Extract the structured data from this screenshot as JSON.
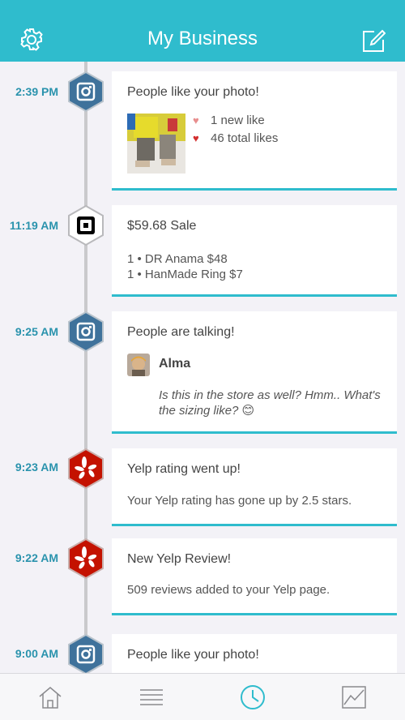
{
  "header": {
    "title": "My Business",
    "icons": [
      "gear-icon",
      "compose-icon"
    ]
  },
  "colors": {
    "accent": "#2fbccd",
    "time": "#2a93ad",
    "instagram": "#3f729b",
    "yelp": "#c41200",
    "square": "#000000"
  },
  "events": [
    {
      "time": "2:39 PM",
      "icon": "instagram-icon",
      "title": "People like your photo!",
      "new_likes": "1 new like",
      "total_likes": "46 total likes"
    },
    {
      "time": "11:19 AM",
      "icon": "square-icon",
      "title": "$59.68 Sale",
      "items": [
        "1 • DR Anama $48",
        "1 • HanMade Ring $7"
      ]
    },
    {
      "time": "9:25 AM",
      "icon": "instagram-icon",
      "title": "People are talking!",
      "commenter": "Alma",
      "comment": "Is this in the store as well?  Hmm.. What's the sizing like? 😊"
    },
    {
      "time": "9:23 AM",
      "icon": "yelp-icon",
      "title": "Yelp rating went up!",
      "body": "Your Yelp rating has gone up by 2.5 stars."
    },
    {
      "time": "9:22 AM",
      "icon": "yelp-icon",
      "title": "New Yelp Review!",
      "body": "509 reviews added to your Yelp page."
    },
    {
      "time": "9:00 AM",
      "icon": "instagram-icon",
      "title": "People like your photo!"
    }
  ],
  "tabbar": {
    "tabs": [
      "home-icon",
      "list-icon",
      "clock-icon",
      "chart-icon"
    ],
    "active": "clock-icon"
  }
}
